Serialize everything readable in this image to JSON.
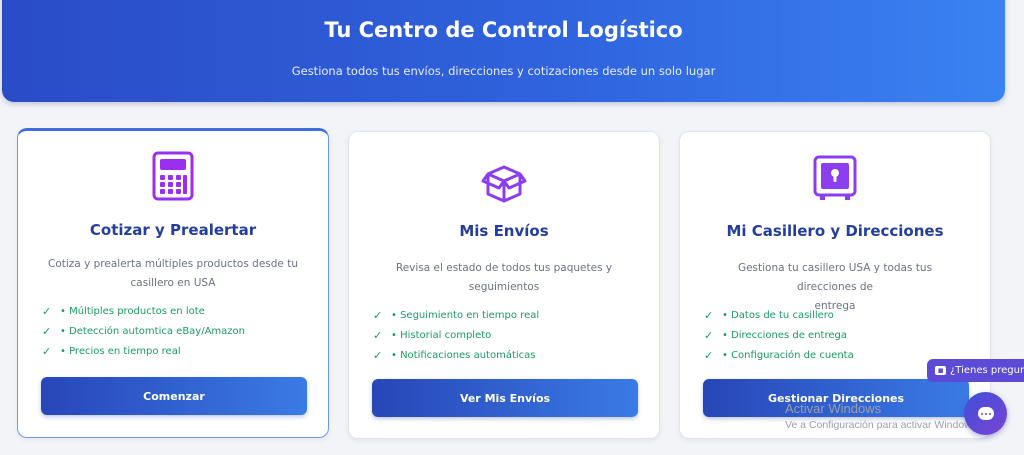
{
  "hero": {
    "title": "Tu Centro de Control Logístico",
    "subtitle": "Gestiona todos tus envíos, direcciones y cotizaciones desde un solo lugar"
  },
  "cards": [
    {
      "icon": "calculator-icon",
      "title": "Cotizar y Prealertar",
      "desc_line1": "Cotiza y prealerta múltiples productos desde tu",
      "desc_line2": "casillero en USA",
      "features": [
        "• Múltiples productos en lote",
        "• Detección automtica eBay/Amazon",
        "• Precios en tiempo real"
      ],
      "button": "Comenzar"
    },
    {
      "icon": "package-box-icon",
      "title": "Mis Envíos",
      "desc_line1": "Revisa el estado de todos tus paquetes y",
      "desc_line2": "seguimientos",
      "features": [
        "• Seguimiento en tiempo real",
        "• Historial completo",
        "• Notificaciones automáticas"
      ],
      "button": "Ver Mis Envíos"
    },
    {
      "icon": "safe-lock-icon",
      "title": "Mi Casillero y Direcciones",
      "desc_line1": "Gestiona tu casillero USA y todas tus direcciones de",
      "desc_line2": "entrega",
      "features": [
        "• Datos de tu casillero",
        "• Direcciones de entrega",
        "• Configuración de cuenta"
      ],
      "button": "Gestionar Direcciones"
    }
  ],
  "check_glyph": "✓",
  "chat": {
    "prompt": "¿Tienes pregunt"
  },
  "windows_watermark": {
    "line1": "Activar Windows",
    "line2": "Ve a Configuración para activar Windows."
  },
  "colors": {
    "accent": "#2f63dd",
    "title": "#253e9e",
    "feature": "#1a9a63",
    "icon": "#8b3df0"
  }
}
